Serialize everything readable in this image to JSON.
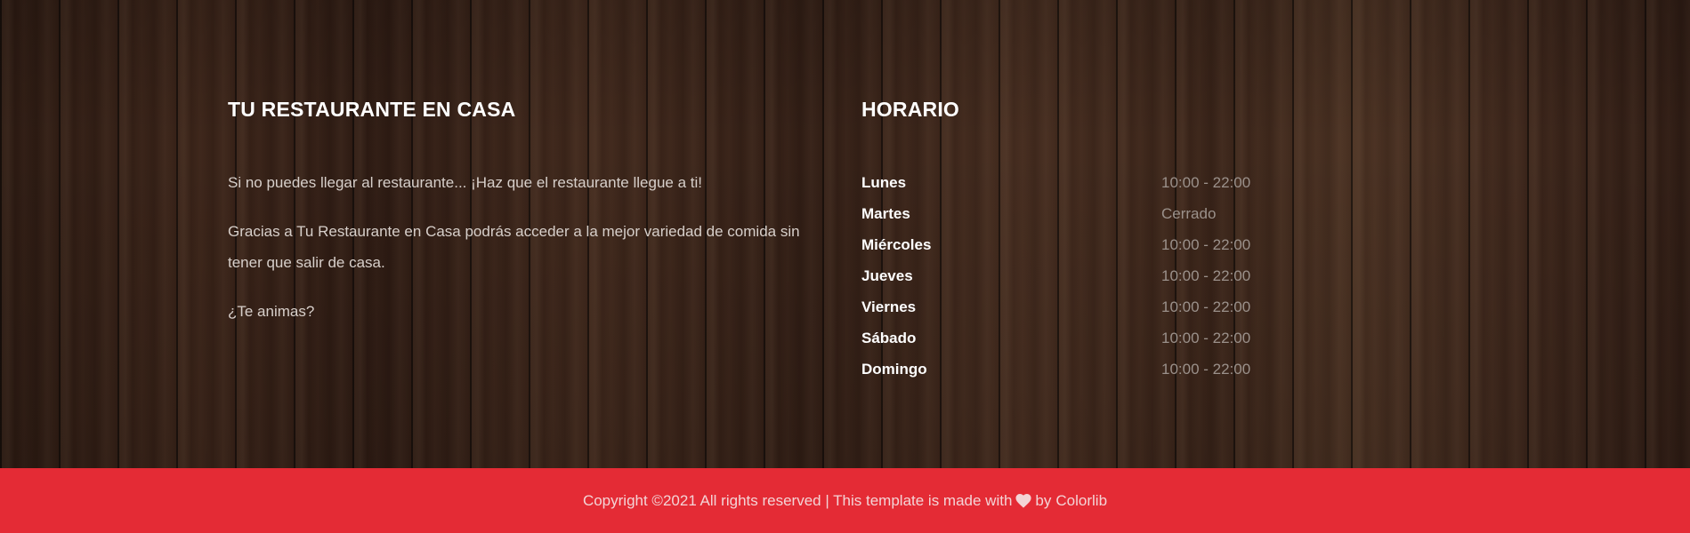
{
  "about": {
    "heading": "TU RESTAURANTE EN CASA",
    "paragraphs": [
      "Si no puedes llegar al restaurante... ¡Haz que el restaurante llegue a ti!",
      "Gracias a Tu Restaurante en Casa podrás acceder a la mejor variedad de comida sin tener que salir de casa.",
      "¿Te animas?"
    ]
  },
  "hours": {
    "heading": "HORARIO",
    "days": [
      {
        "day": "Lunes",
        "time": "10:00 - 22:00"
      },
      {
        "day": "Martes",
        "time": "Cerrado"
      },
      {
        "day": "Miércoles",
        "time": "10:00 - 22:00"
      },
      {
        "day": "Jueves",
        "time": "10:00 - 22:00"
      },
      {
        "day": "Viernes",
        "time": "10:00 - 22:00"
      },
      {
        "day": "Sábado",
        "time": "10:00 - 22:00"
      },
      {
        "day": "Domingo",
        "time": "10:00 - 22:00"
      }
    ]
  },
  "copyright": {
    "prefix": "Copyright ©2021 All rights reserved | This template is made with",
    "icon": "heart-icon",
    "suffix": "by",
    "link_text": "Colorlib"
  },
  "colors": {
    "copyright_bar": "#e42b35",
    "heading": "#ffffff",
    "closed_text": "#9b918b"
  }
}
